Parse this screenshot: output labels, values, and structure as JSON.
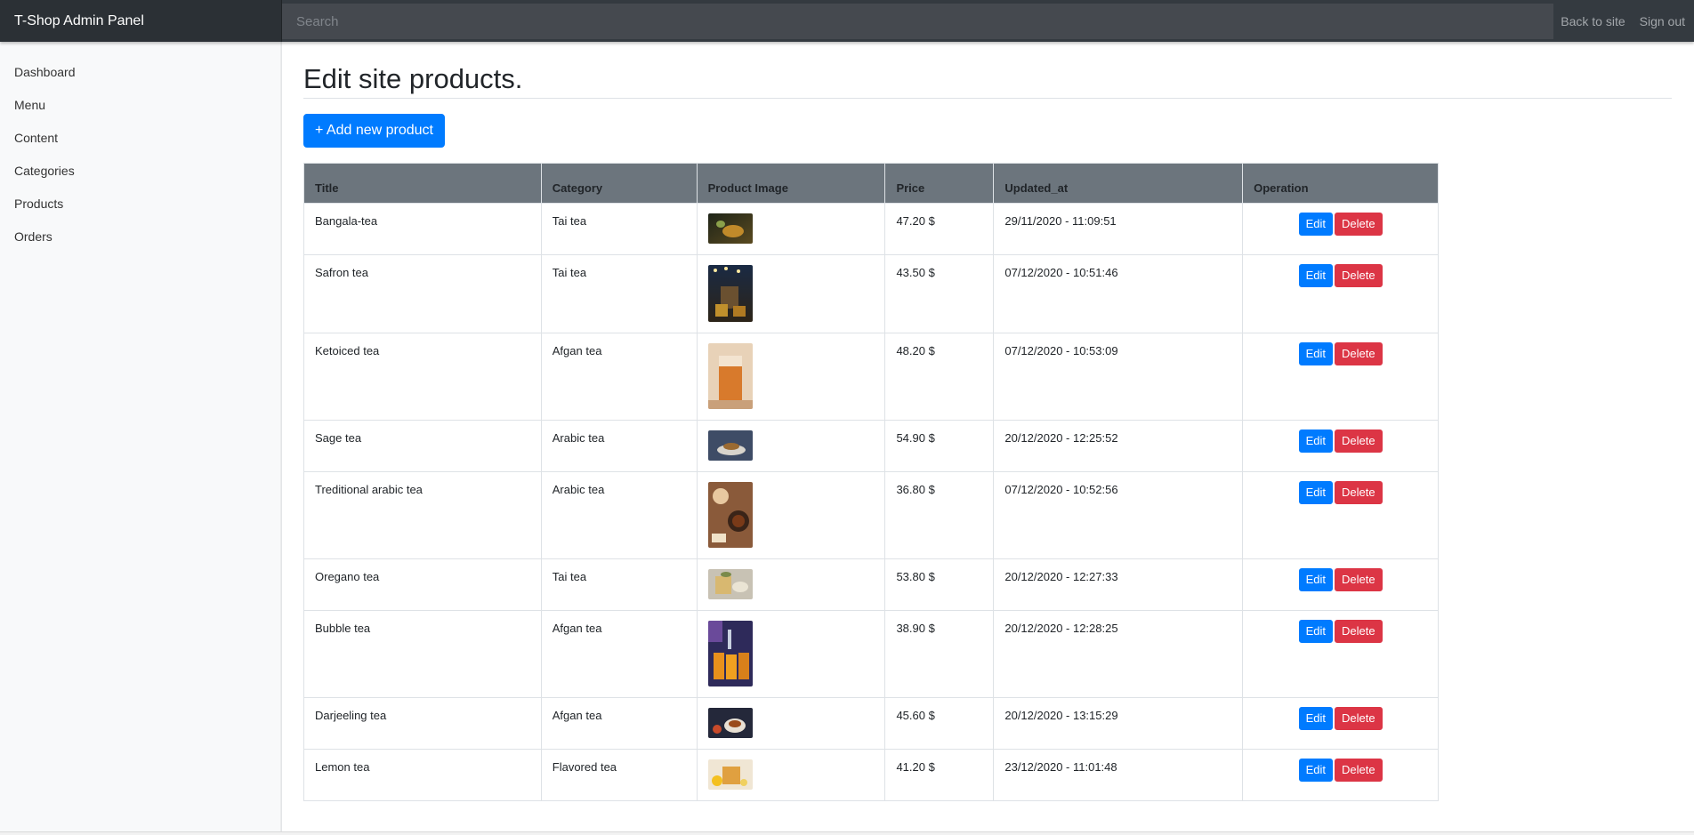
{
  "navbar": {
    "brand": "T-Shop Admin Panel",
    "search_placeholder": "Search",
    "links": [
      "Back to site",
      "Sign out"
    ]
  },
  "sidebar": {
    "items": [
      "Dashboard",
      "Menu",
      "Content",
      "Categories",
      "Products",
      "Orders"
    ]
  },
  "main": {
    "title": "Edit site products.",
    "add_button": "+ Add new product",
    "table": {
      "headers": [
        "Title",
        "Category",
        "Product Image",
        "Price",
        "Updated_at",
        "Operation"
      ],
      "edit_label": "Edit",
      "delete_label": "Delete",
      "rows": [
        {
          "title": "Bangala-tea",
          "category": "Tai tea",
          "price": "47.20 $",
          "updated": "29/11/2020 - 11:09:51"
        },
        {
          "title": "Safron tea",
          "category": "Tai tea",
          "price": "43.50 $",
          "updated": "07/12/2020 - 10:51:46"
        },
        {
          "title": "Ketoiced tea",
          "category": "Afgan tea",
          "price": "48.20 $",
          "updated": "07/12/2020 - 10:53:09"
        },
        {
          "title": "Sage tea",
          "category": "Arabic tea",
          "price": "54.90 $",
          "updated": "20/12/2020 - 12:25:52"
        },
        {
          "title": "Treditional arabic tea",
          "category": "Arabic tea",
          "price": "36.80 $",
          "updated": "07/12/2020 - 10:52:56"
        },
        {
          "title": "Oregano tea",
          "category": "Tai tea",
          "price": "53.80 $",
          "updated": "20/12/2020 - 12:27:33"
        },
        {
          "title": "Bubble tea",
          "category": "Afgan tea",
          "price": "38.90 $",
          "updated": "20/12/2020 - 12:28:25"
        },
        {
          "title": "Darjeeling tea",
          "category": "Afgan tea",
          "price": "45.60 $",
          "updated": "20/12/2020 - 13:15:29"
        },
        {
          "title": "Lemon tea",
          "category": "Flavored tea",
          "price": "41.20 $",
          "updated": "23/12/2020 - 11:01:48"
        }
      ]
    }
  },
  "colors": {
    "navbar": "#343a40",
    "primary": "#007bff",
    "danger": "#dc3545",
    "table_header": "#6c757d"
  }
}
